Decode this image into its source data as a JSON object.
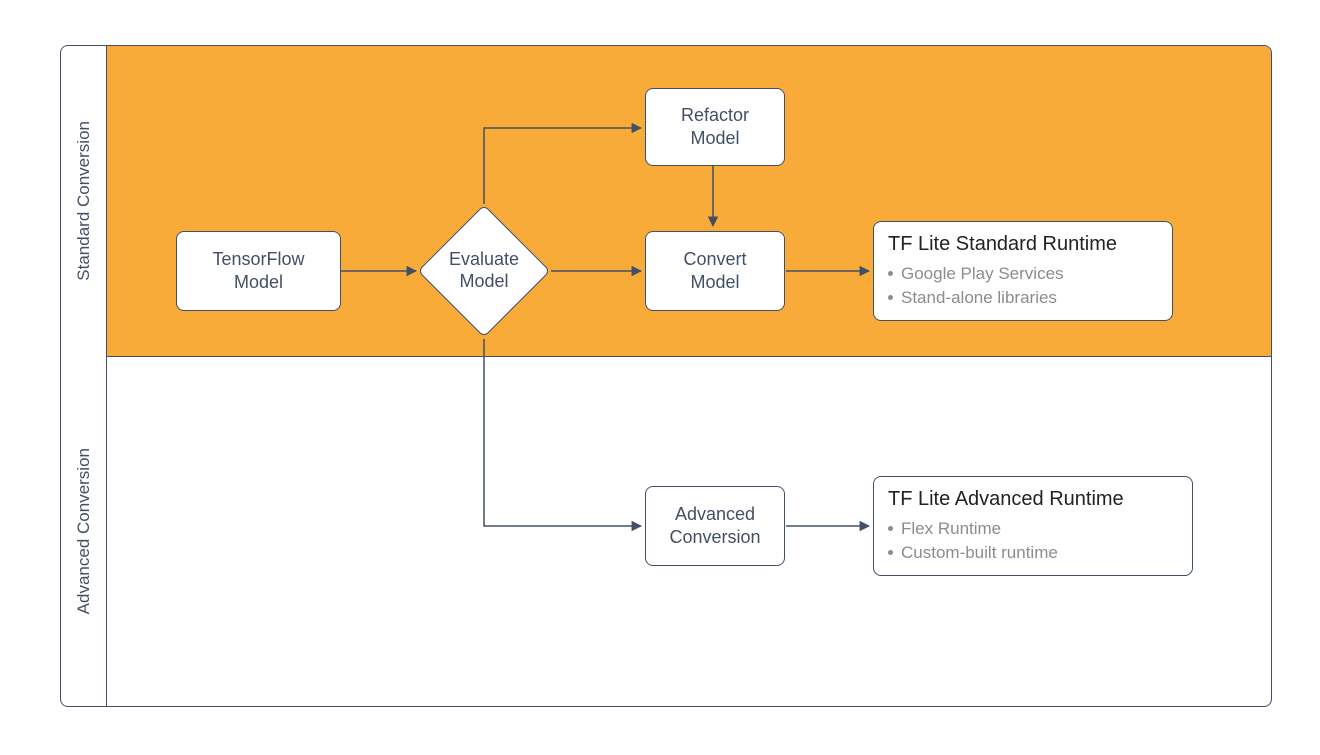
{
  "sections": {
    "standard_label": "Standard Conversion",
    "advanced_label": "Advanced Conversion"
  },
  "nodes": {
    "tensorflow_model": {
      "line1": "TensorFlow",
      "line2": "Model"
    },
    "evaluate_model": {
      "line1": "Evaluate",
      "line2": "Model"
    },
    "refactor_model": {
      "line1": "Refactor",
      "line2": "Model"
    },
    "convert_model": {
      "line1": "Convert",
      "line2": "Model"
    },
    "advanced_conversion": {
      "line1": "Advanced",
      "line2": "Conversion"
    },
    "standard_runtime": {
      "title": "TF Lite Standard Runtime",
      "bullets": [
        "Google Play Services",
        "Stand-alone libraries"
      ]
    },
    "advanced_runtime": {
      "title": "TF Lite Advanced Runtime",
      "bullets": [
        "Flex Runtime",
        "Custom-built runtime"
      ]
    }
  },
  "colors": {
    "highlight": "#F9AB3A",
    "stroke": "#425066",
    "muted": "#8c8c8c"
  }
}
